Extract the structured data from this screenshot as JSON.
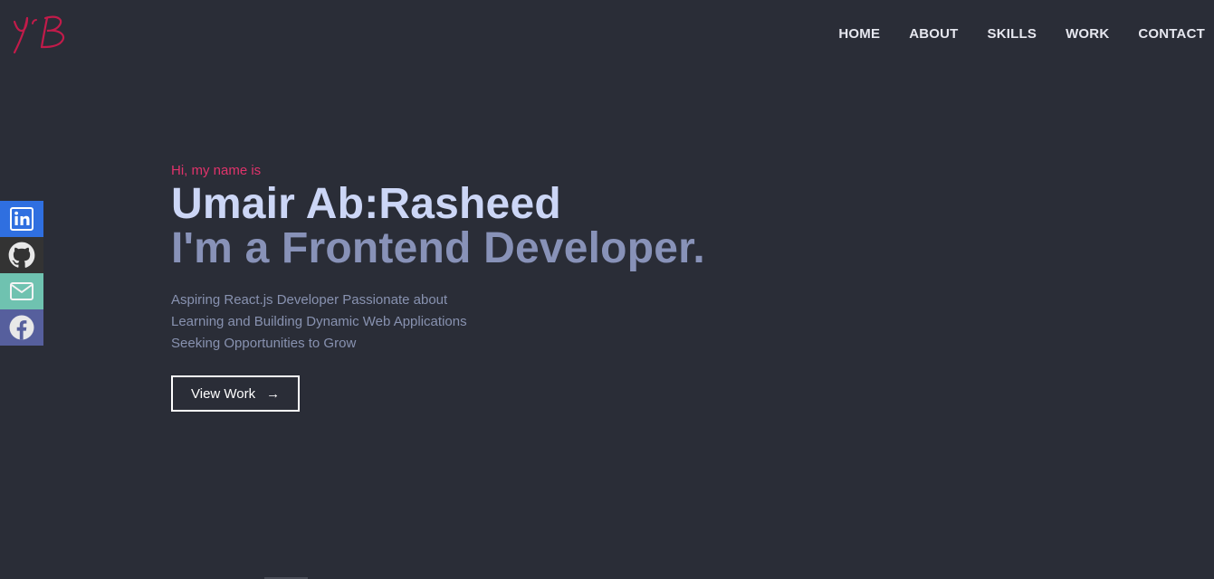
{
  "logo": {
    "text": "YB",
    "color": "#c21b4a"
  },
  "nav": {
    "items": [
      {
        "label": "HOME"
      },
      {
        "label": "ABOUT"
      },
      {
        "label": "SKILLS"
      },
      {
        "label": "WORK"
      },
      {
        "label": "CONTACT"
      }
    ]
  },
  "social": [
    {
      "icon": "linkedin-icon",
      "color": "#2f6fe0"
    },
    {
      "icon": "github-icon",
      "color": "#333333"
    },
    {
      "icon": "mail-icon",
      "color": "#6fc2b0"
    },
    {
      "icon": "facebook-icon",
      "color": "#565f9d"
    }
  ],
  "hero": {
    "intro": "Hi, my name is",
    "name": "Umair Ab:Rasheed",
    "role": "I'm a Frontend Developer.",
    "description": [
      "Aspiring React.js Developer Passionate about",
      "Learning and Building Dynamic Web Applications",
      "Seeking Opportunities to Grow"
    ],
    "button_label": "View Work",
    "button_arrow": "→"
  },
  "colors": {
    "background": "#2a2d37",
    "accent": "#e0336b",
    "heading": "#ccd6f6",
    "subheading": "#8892b8"
  }
}
